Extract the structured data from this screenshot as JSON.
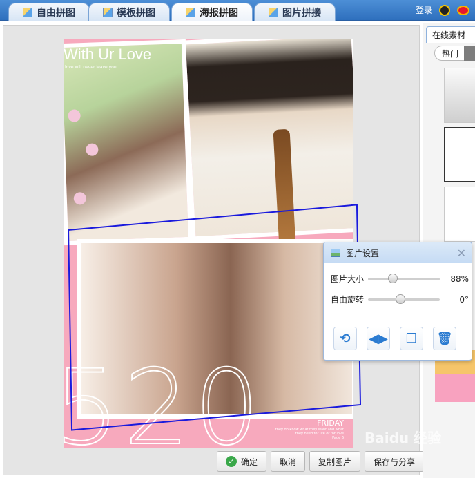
{
  "tabs": [
    {
      "label": "自由拼图",
      "active": false
    },
    {
      "label": "模板拼图",
      "active": false
    },
    {
      "label": "海报拼图",
      "active": true
    },
    {
      "label": "图片拼接",
      "active": false
    }
  ],
  "header": {
    "login": "登录"
  },
  "poster": {
    "title": "With Ur Love",
    "subtitle": "love will never leave you",
    "big_number": "520",
    "day": "FRIDAY",
    "day_note_1": "they do know what they want and what",
    "day_note_2": "they need for life or for love",
    "page_label": "Page 6"
  },
  "dialog": {
    "title": "图片设置",
    "size_label": "图片大小",
    "size_value": "88%",
    "size_fraction": 0.35,
    "rotate_label": "自由旋转",
    "rotate_value": "0°",
    "rotate_fraction": 0.45
  },
  "actions": {
    "confirm": "确定",
    "cancel": "取消",
    "copy": "复制图片",
    "save": "保存与分享"
  },
  "sidebar": {
    "tab": "在线素材",
    "filter_hot": "热门"
  },
  "watermark": "Baidu 经验"
}
